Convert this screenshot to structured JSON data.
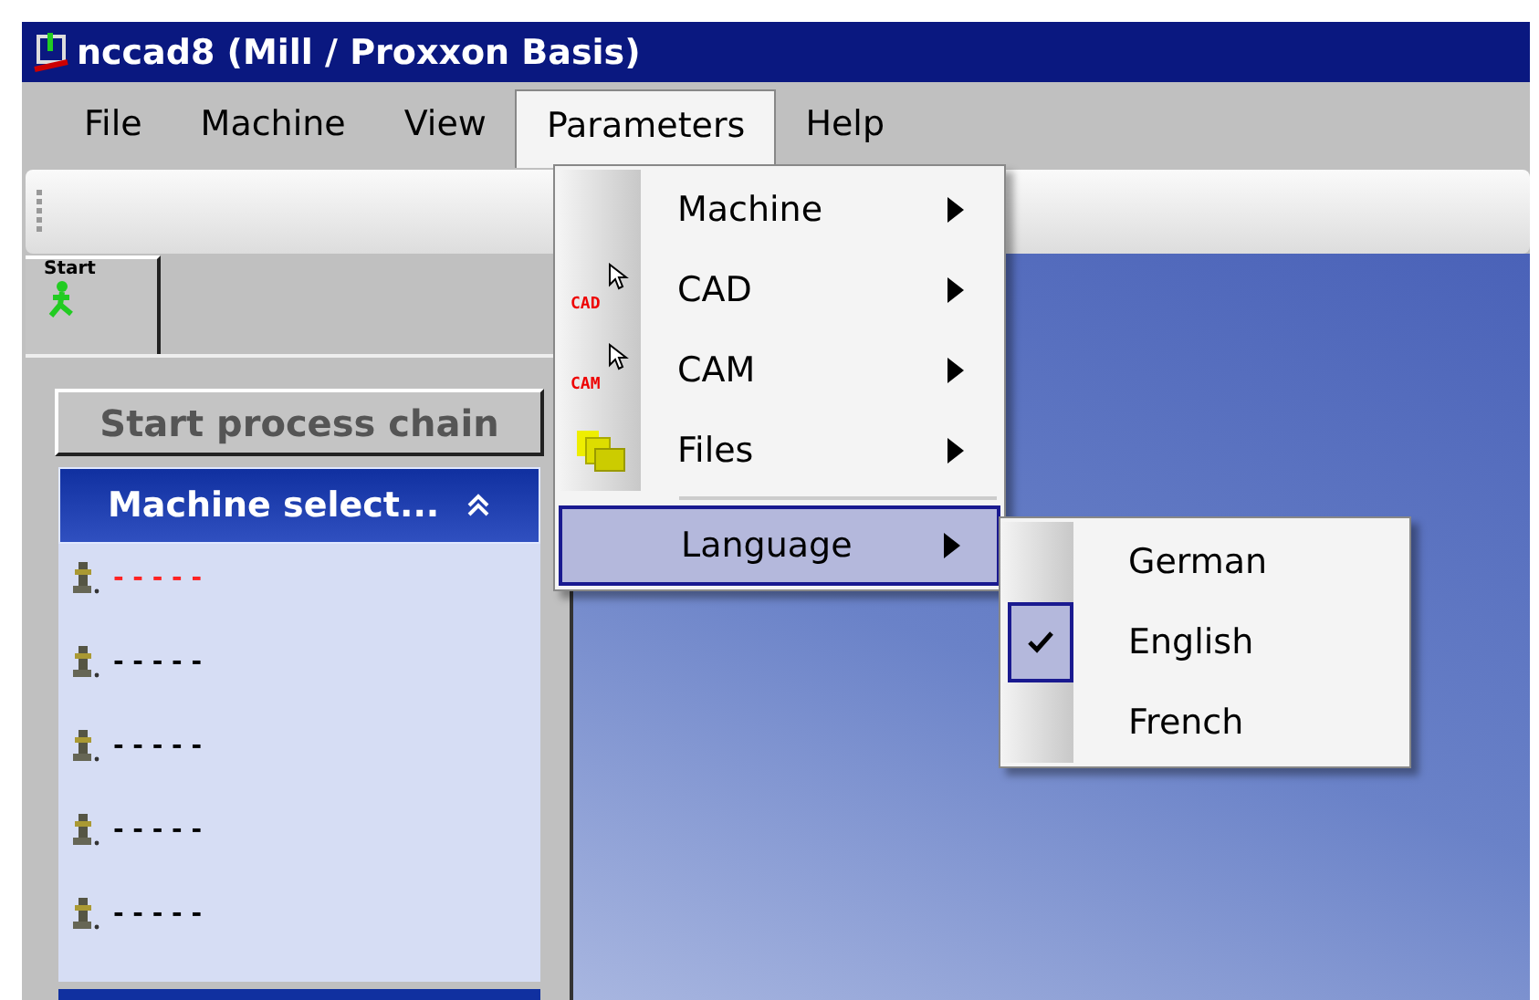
{
  "window": {
    "title": "nccad8 (Mill / Proxxon Basis)"
  },
  "menu_bar": [
    {
      "label": "File",
      "selected": false
    },
    {
      "label": "Machine",
      "selected": false
    },
    {
      "label": "View",
      "selected": false
    },
    {
      "label": "Parameters",
      "selected": true
    },
    {
      "label": "Help",
      "selected": false
    }
  ],
  "sidebar": {
    "tabs": [
      {
        "label": "Start",
        "selected": true
      }
    ],
    "button": "Start process chain",
    "panel": {
      "title": "Machine select...",
      "expanded": true,
      "items": [
        {
          "label": "- - - - -",
          "selected": true
        },
        {
          "label": "- - - - -",
          "selected": false
        },
        {
          "label": "- - - - -",
          "selected": false
        },
        {
          "label": "- - - - -",
          "selected": false
        },
        {
          "label": "- - - - -",
          "selected": false
        }
      ]
    }
  },
  "dropdown": {
    "items": [
      {
        "kind": "plain",
        "label": "Machine",
        "highlighted": false
      },
      {
        "kind": "pointer",
        "label": "CAD",
        "icon_label": "CAD",
        "highlighted": false
      },
      {
        "kind": "pointer",
        "label": "CAM",
        "icon_label": "CAM",
        "highlighted": false
      },
      {
        "kind": "folder",
        "label": "Files",
        "highlighted": false
      },
      {
        "kind": "separator"
      },
      {
        "kind": "plain",
        "label": "Language",
        "highlighted": true
      }
    ]
  },
  "submenu": {
    "items": [
      {
        "label": "German",
        "checked": false
      },
      {
        "label": "English",
        "checked": true
      },
      {
        "label": "French",
        "checked": false
      }
    ]
  }
}
